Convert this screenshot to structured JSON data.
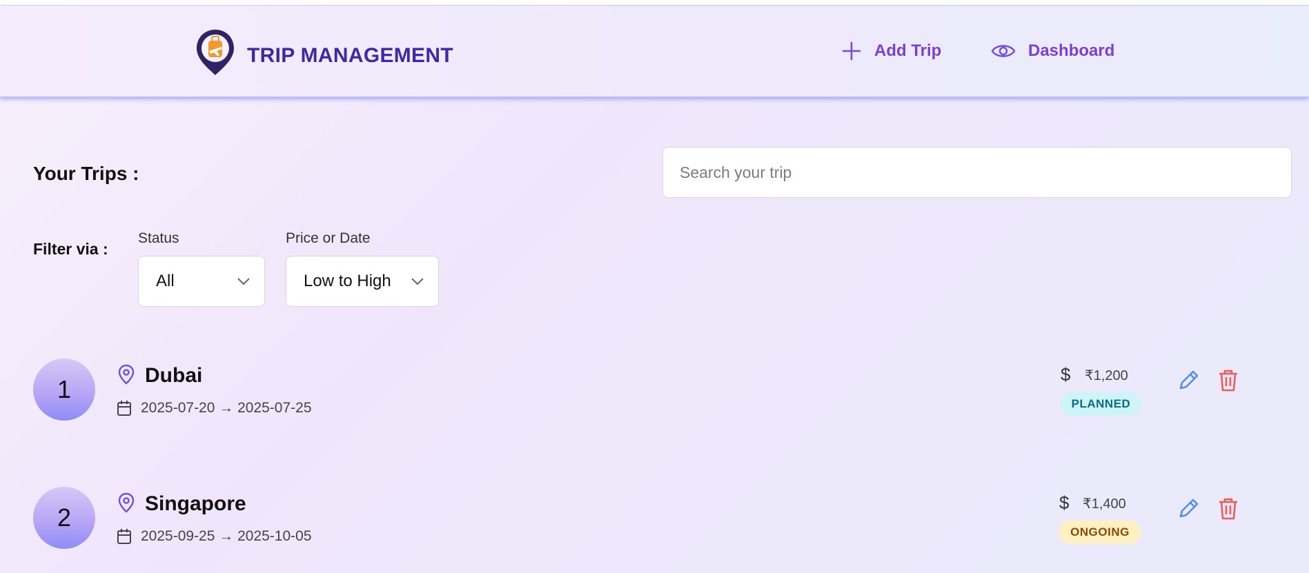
{
  "header": {
    "brand": "TRIP MANAGEMENT",
    "nav": [
      {
        "label": "Add Trip",
        "icon": "plus-icon"
      },
      {
        "label": "Dashboard",
        "icon": "eye-icon"
      }
    ]
  },
  "main": {
    "title": "Your Trips :",
    "search_placeholder": "Search your trip",
    "filter_label": "Filter via :",
    "filters": {
      "status": {
        "label": "Status",
        "value": "All"
      },
      "sort": {
        "label": "Price or Date",
        "value": "Low to High"
      }
    }
  },
  "trips": [
    {
      "index": "1",
      "destination": "Dubai",
      "dates": "2025-07-20 → 2025-07-25",
      "currency_symbol": "$",
      "price": "₹1,200",
      "status": "PLANNED"
    },
    {
      "index": "2",
      "destination": "Singapore",
      "dates": "2025-09-25 → 2025-10-05",
      "currency_symbol": "$",
      "price": "₹1,400",
      "status": "ONGOING"
    }
  ],
  "colors": {
    "brand": "#3b2aa6",
    "nav_link": "#7a3fd6",
    "edit": "#4f8fe8",
    "delete": "#ef5a5a",
    "planned_bg": "#cdf4f7",
    "ongoing_bg": "#fdf0c2"
  }
}
